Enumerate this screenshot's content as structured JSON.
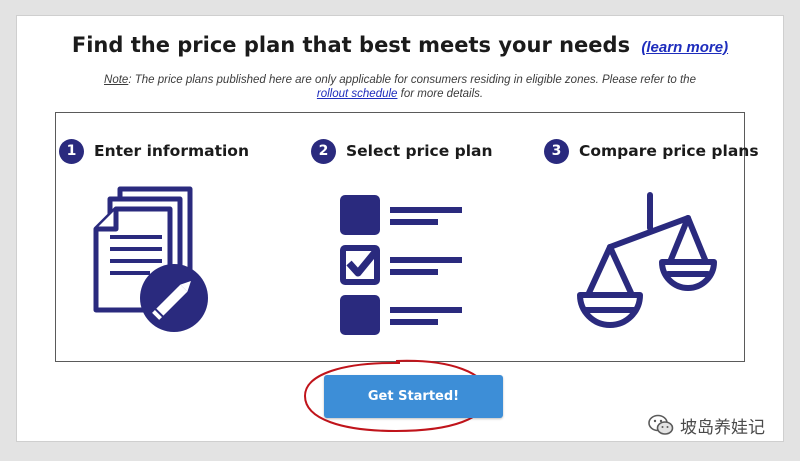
{
  "header": {
    "title": "Find the price plan that best meets your needs",
    "learn_more": "(learn more)"
  },
  "note": {
    "label": "Note",
    "text_before": ": The price plans published here are only applicable for consumers residing in eligible zones. Please refer to the",
    "link": "rollout schedule",
    "text_after": "for more details."
  },
  "steps": [
    {
      "number": "1",
      "label": "Enter information",
      "icon": "document-edit-icon"
    },
    {
      "number": "2",
      "label": "Select price plan",
      "icon": "checklist-icon"
    },
    {
      "number": "3",
      "label": "Compare price plans",
      "icon": "balance-scale-icon"
    }
  ],
  "cta": {
    "label": "Get Started!"
  },
  "watermark": {
    "text": "坡岛养娃记",
    "icon": "wechat-icon"
  },
  "colors": {
    "navy": "#2a2a7e",
    "link_blue": "#1e2dbd",
    "button_blue": "#3d8ed7",
    "annotation_red": "#c0141b"
  }
}
